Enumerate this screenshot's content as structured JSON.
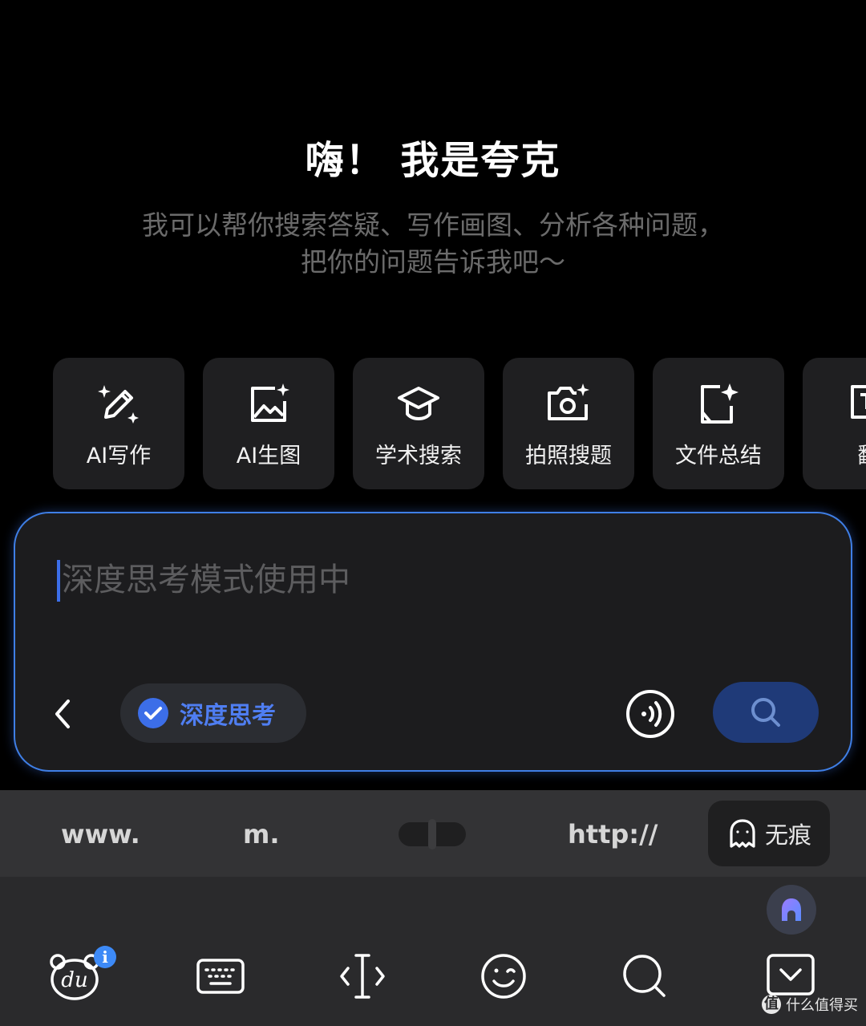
{
  "hero": {
    "title": "嗨！ 我是夸克",
    "subtitle_line1": "我可以帮你搜索答疑、写作画图、分析各种问题，",
    "subtitle_line2": "把你的问题告诉我吧～"
  },
  "tools": [
    {
      "label": "AI写作",
      "icon": "pencil-sparkle-icon"
    },
    {
      "label": "AI生图",
      "icon": "image-sparkle-icon"
    },
    {
      "label": "学术搜索",
      "icon": "graduation-cap-icon"
    },
    {
      "label": "拍照搜题",
      "icon": "camera-sparkle-icon"
    },
    {
      "label": "文件总结",
      "icon": "document-sparkle-icon"
    },
    {
      "label": "翻",
      "icon": "translate-icon"
    }
  ],
  "input": {
    "placeholder": "深度思考模式使用中",
    "value": "",
    "deep_think_label": "深度思考",
    "accent_color": "#3f7fe6"
  },
  "keyboard_toolbar": {
    "www": "www.",
    "m": "m.",
    "http": "http://",
    "incognito_label": "无痕"
  },
  "keyboard_icons": [
    "du-bear-icon",
    "keyboard-icon",
    "cursor-move-icon",
    "emoji-icon",
    "search-icon",
    "collapse-keyboard-icon"
  ],
  "badge": "i",
  "watermark": {
    "logo": "值",
    "text": "什么值得买"
  }
}
